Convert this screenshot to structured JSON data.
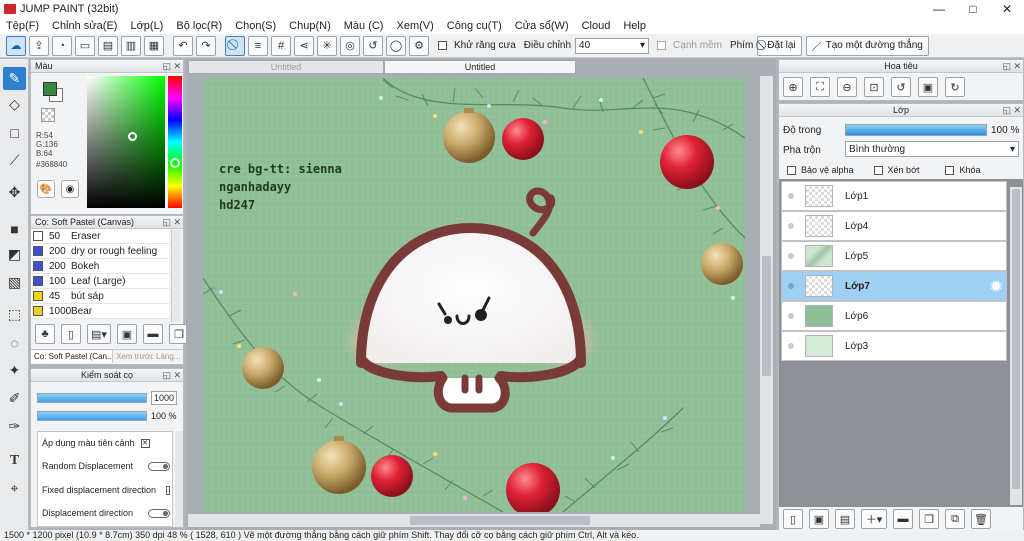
{
  "window": {
    "title": "JUMP PAINT (32bit)",
    "min": "—",
    "max": "□",
    "close": "✕"
  },
  "menu": [
    "Tệp(F)",
    "Chỉnh sửa(E)",
    "Lớp(L)",
    "Bộ lọc(R)",
    "Chọn(S)",
    "Chup(N)",
    "Màu (C)",
    "Xem(V)",
    "Công cụ(T)",
    "Cửa sổ(W)",
    "Cloud",
    "Help"
  ],
  "toolbar": {
    "antialias_label": "Khử răng cưa",
    "adjust_label": "Điều chỉnh",
    "adjust_value": "40",
    "smooth_label": "Cạnh mềm",
    "key_label": "Phím",
    "reset_label": "Đặt lại",
    "straight_line_label": "Tạo một đường thẳng"
  },
  "color_panel": {
    "title": "Màu",
    "r": "R:54",
    "g": "G:136",
    "b": "B:64",
    "hex": "#368840",
    "fg_color": "#368840",
    "bg_color": "#ffffff"
  },
  "brush_panel": {
    "title": "Cọ: Soft Pastel (Canvas)",
    "items": [
      {
        "size": "50",
        "name": "Eraser",
        "color": "#ffffff"
      },
      {
        "size": "200",
        "name": "dry or rough feeling",
        "color": "#3a52d8"
      },
      {
        "size": "200",
        "name": "Bokeh",
        "color": "#3a52d8"
      },
      {
        "size": "100",
        "name": "Leaf (Large)",
        "color": "#3a52d8"
      },
      {
        "size": "45",
        "name": "bút sáp",
        "color": "#e8d21c"
      },
      {
        "size": "1000",
        "name": "Bear",
        "color": "#e8d21c"
      }
    ],
    "tabs": [
      "Cọ: Soft Pastel (Can...",
      "Xem trước...",
      "Láng..."
    ]
  },
  "control_panel": {
    "title": "Kiểm soát cọ",
    "size_value": "1000",
    "opacity_value": "100 %",
    "size_fill": 1.0,
    "opacity_fill": 1.0,
    "apply_color_label": "Áp dụng màu tiên cảnh",
    "random_disp_label": "Random Displacement",
    "fixed_disp_label": "Fixed displacement direction",
    "disp_dir_label": "Displacement direction"
  },
  "doc_tabs": [
    "Untitled",
    "Untitled"
  ],
  "artwork": {
    "credit_lines": [
      "cre bg-tt: sienna",
      "nganhadayy",
      "hd247"
    ],
    "face": "•ᴥ•"
  },
  "nav_panel": {
    "title": "Hoa tiêu"
  },
  "layer_panel": {
    "title": "Lớp",
    "opacity_label": "Độ trong",
    "opacity_value": "100 %",
    "opacity_fill": 1.0,
    "blend_label": "Pha trộn",
    "blend_value": "Bình thường",
    "protect_alpha": "Bảo vệ alpha",
    "clipping": "Xén bớt",
    "lock": "Khóa",
    "layers": [
      {
        "name": "Lớp1",
        "selected": false
      },
      {
        "name": "Lớp4",
        "selected": false
      },
      {
        "name": "Lớp5",
        "selected": false
      },
      {
        "name": "Lớp7",
        "selected": true
      },
      {
        "name": "Lớp6",
        "selected": false
      },
      {
        "name": "Lớp3",
        "selected": false
      }
    ]
  },
  "status": "1500 * 1200 pixel   (10.9 * 8.7cm)   350 dpi   48 %   ( 1528, 610 )   Vẽ một đường thẳng bằng cách giữ phím Shift. Thay đổi cỡ cọ bằng cách giữ phím Ctrl, Alt và kéo.",
  "colors": {
    "accent": "#2f7fd0",
    "selected_layer": "#9fd0f4",
    "canvas_bg": "#8fbd95",
    "ornament_red": "#d8283a",
    "ornament_gold": "#c9a96a",
    "mascot_outline": "#7a3a3a"
  }
}
